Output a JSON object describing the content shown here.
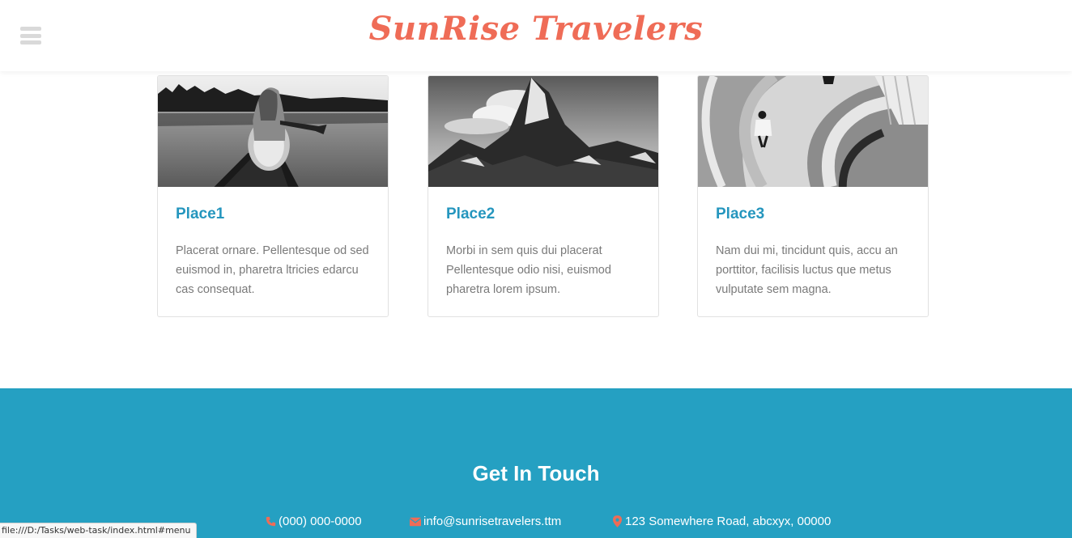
{
  "header": {
    "brand": "SunRise Travelers",
    "brand_color": "#ef6c57"
  },
  "cards": [
    {
      "title": "Place1",
      "text": "Placerat ornare. Pellentesque od sed euismod in, pharetra ltricies edarcu cas consequat.",
      "image": "woman-in-canoe-on-lake-bw"
    },
    {
      "title": "Place2",
      "text": "Morbi in sem quis dui placerat Pellentesque odio nisi, euismod pharetra lorem ipsum.",
      "image": "mountain-peak-bw"
    },
    {
      "title": "Place3",
      "text": "Nam dui mi, tincidunt quis, accu an porttitor, facilisis luctus que metus vulputate sem magna.",
      "image": "spiral-staircase-bw"
    }
  ],
  "footer": {
    "title": "Get In Touch",
    "background": "#25a0c2",
    "icon_color": "#ef6c57",
    "phone": "(000) 000-0000",
    "email": "info@sunrisetravelers.ttm",
    "address": "123 Somewhere Road, abcxyx, 00000"
  },
  "statusbar": {
    "url": "file:///D:/Tasks/web-task/index.html#menu"
  }
}
